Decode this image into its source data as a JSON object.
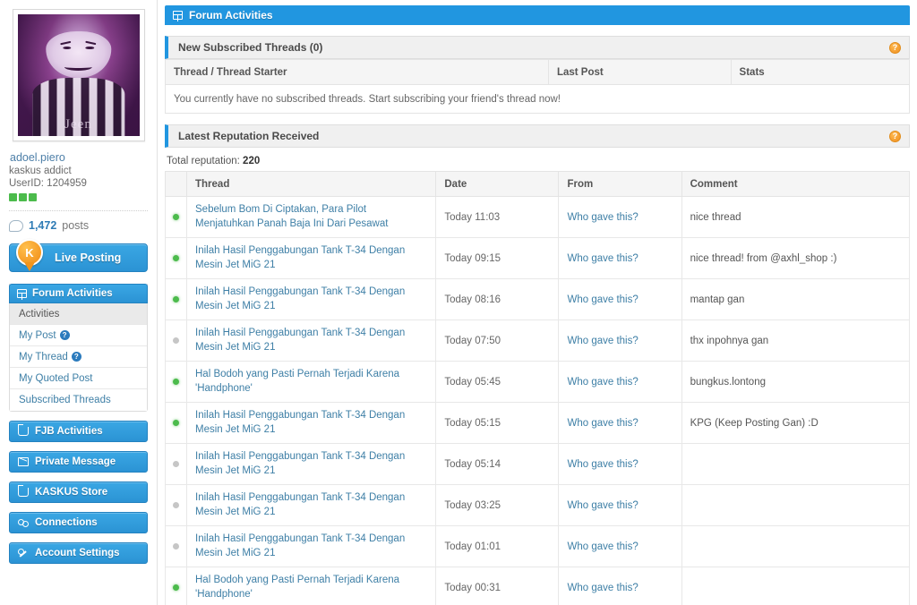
{
  "profile": {
    "avatar_alt": "user-avatar-photo",
    "avatar_caption": "Jeen",
    "username": "adoel.piero",
    "user_title": "kaskus addict",
    "user_id_label": "UserID: 1204959",
    "reputation_bars": 3,
    "posts_count": "1,472",
    "posts_word": "posts"
  },
  "sidebar": {
    "live_posting": {
      "label": "Live Posting",
      "icon": "kaskus-k-logo-icon"
    },
    "menu": {
      "header": "Forum Activities",
      "header_icon": "grid-icon",
      "items": [
        {
          "label": "Activities",
          "active": true,
          "help": false
        },
        {
          "label": "My Post",
          "active": false,
          "help": true
        },
        {
          "label": "My Thread",
          "active": false,
          "help": true
        },
        {
          "label": "My Quoted Post",
          "active": false,
          "help": false
        },
        {
          "label": "Subscribed Threads",
          "active": false,
          "help": false
        }
      ]
    },
    "nav_buttons": [
      {
        "label": "FJB Activities",
        "icon": "cart-icon"
      },
      {
        "label": "Private Message",
        "icon": "envelope-icon"
      },
      {
        "label": "KASKUS Store",
        "icon": "cart-icon"
      },
      {
        "label": "Connections",
        "icon": "connections-icon"
      },
      {
        "label": "Account Settings",
        "icon": "wrench-icon"
      }
    ]
  },
  "main": {
    "panel_title": "Forum Activities",
    "panel_title_icon": "grid-icon",
    "subscribed": {
      "section_label": "New Subscribed Threads (0)",
      "help_icon": "help-circle-icon",
      "columns": [
        "Thread / Thread Starter",
        "Last Post",
        "Stats"
      ],
      "empty_message": "You currently have no subscribed threads. Start subscribing your friend's thread now!"
    },
    "reputation": {
      "section_label": "Latest Reputation Received",
      "help_icon": "help-circle-icon",
      "total_label": "Total reputation:",
      "total_value": "220",
      "columns": [
        "Thread",
        "Date",
        "From",
        "Comment"
      ],
      "from_link_text": "Who gave this?",
      "rows": [
        {
          "status": "pos",
          "thread": "Sebelum Bom Di Ciptakan, Para Pilot Menjatuhkan Panah Baja Ini Dari Pesawat",
          "date": "Today 11:03",
          "from": "Who gave this?",
          "comment": "nice thread"
        },
        {
          "status": "pos",
          "thread": "Inilah Hasil Penggabungan Tank T-34 Dengan Mesin Jet MiG 21",
          "date": "Today 09:15",
          "from": "Who gave this?",
          "comment": "nice thread! from @axhl_shop :)"
        },
        {
          "status": "pos",
          "thread": "Inilah Hasil Penggabungan Tank T-34 Dengan Mesin Jet MiG 21",
          "date": "Today 08:16",
          "from": "Who gave this?",
          "comment": "mantap gan"
        },
        {
          "status": "neu",
          "thread": "Inilah Hasil Penggabungan Tank T-34 Dengan Mesin Jet MiG 21",
          "date": "Today 07:50",
          "from": "Who gave this?",
          "comment": "thx inpohnya gan"
        },
        {
          "status": "pos",
          "thread": "Hal Bodoh yang Pasti Pernah Terjadi Karena 'Handphone'",
          "date": "Today 05:45",
          "from": "Who gave this?",
          "comment": "bungkus.lontong"
        },
        {
          "status": "pos",
          "thread": "Inilah Hasil Penggabungan Tank T-34 Dengan Mesin Jet MiG 21",
          "date": "Today 05:15",
          "from": "Who gave this?",
          "comment": "KPG (Keep Posting Gan) :D"
        },
        {
          "status": "neu",
          "thread": "Inilah Hasil Penggabungan Tank T-34 Dengan Mesin Jet MiG 21",
          "date": "Today 05:14",
          "from": "Who gave this?",
          "comment": ""
        },
        {
          "status": "neu",
          "thread": "Inilah Hasil Penggabungan Tank T-34 Dengan Mesin Jet MiG 21",
          "date": "Today 03:25",
          "from": "Who gave this?",
          "comment": ""
        },
        {
          "status": "neu",
          "thread": "Inilah Hasil Penggabungan Tank T-34 Dengan Mesin Jet MiG 21",
          "date": "Today 01:01",
          "from": "Who gave this?",
          "comment": ""
        },
        {
          "status": "pos",
          "thread": "Hal Bodoh yang Pasti Pernah Terjadi Karena 'Handphone'",
          "date": "Today 00:31",
          "from": "Who gave this?",
          "comment": ""
        }
      ]
    }
  },
  "colors": {
    "accent_blue": "#2196e0",
    "link_blue": "#3e7fa6",
    "help_orange": "#ef9020",
    "positive_green": "#4cbb4c",
    "neutral_gray": "#c6c6c6"
  }
}
